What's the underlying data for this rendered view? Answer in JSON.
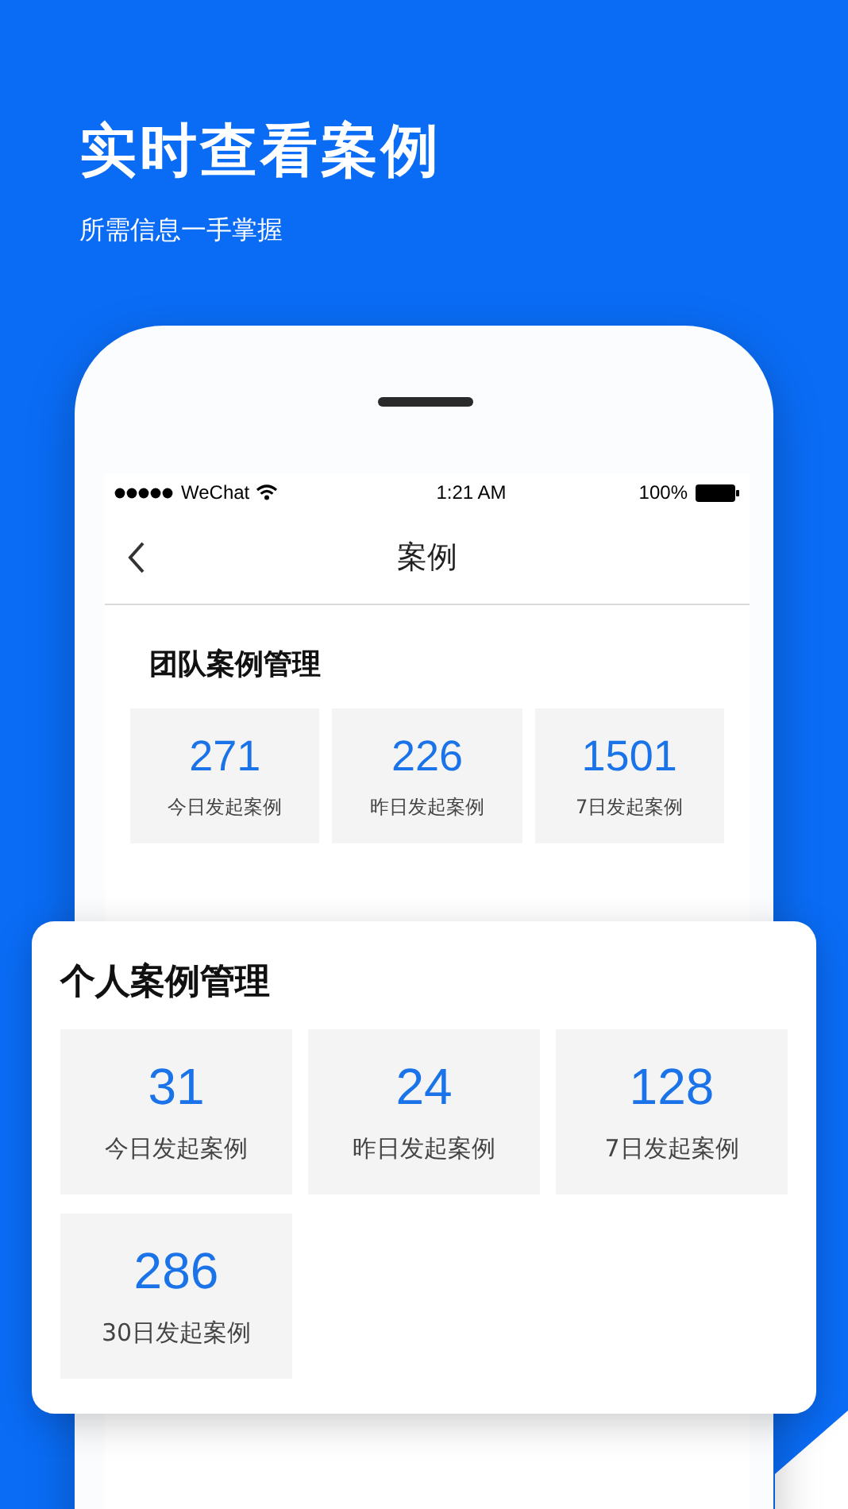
{
  "hero": {
    "title": "实时查看案例",
    "subtitle": "所需信息一手掌握"
  },
  "status_bar": {
    "carrier": "WeChat",
    "time": "1:21 AM",
    "battery": "100%"
  },
  "nav": {
    "title": "案例"
  },
  "team": {
    "title": "团队案例管理",
    "stats": [
      {
        "value": "271",
        "label": "今日发起案例"
      },
      {
        "value": "226",
        "label": "昨日发起案例"
      },
      {
        "value": "1501",
        "label": "7日发起案例"
      }
    ]
  },
  "personal": {
    "title": "个人案例管理",
    "stats": [
      {
        "value": "31",
        "label": "今日发起案例"
      },
      {
        "value": "24",
        "label": "昨日发起案例"
      },
      {
        "value": "128",
        "label": "7日发起案例"
      },
      {
        "value": "286",
        "label": "30日发起案例"
      }
    ]
  }
}
